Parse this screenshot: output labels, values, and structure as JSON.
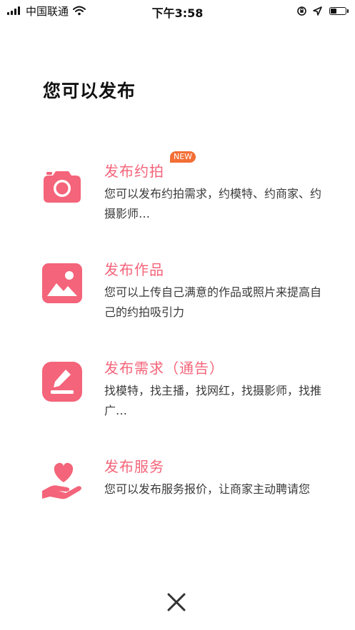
{
  "status_bar": {
    "carrier": "中国联通",
    "time": "下午3:58",
    "battery_level": 0.35
  },
  "page": {
    "title": "您可以发布"
  },
  "options": [
    {
      "title": "发布约拍",
      "description": "您可以发布约拍需求，约模特、约商家、约摄影师…",
      "badge": "NEW",
      "icon": "camera-icon"
    },
    {
      "title": "发布作品",
      "description": "您可以上传自己满意的作品或照片来提高自己的约拍吸引力",
      "icon": "image-icon"
    },
    {
      "title": "发布需求（通告）",
      "description": "找模特，找主播，找网红，找摄影师，找推广…",
      "icon": "edit-icon"
    },
    {
      "title": "发布服务",
      "description": "您可以发布服务报价，让商家主动聘请您",
      "icon": "heart-hand-icon"
    }
  ],
  "colors": {
    "accent": "#f4647a",
    "badge": "#f36f36"
  },
  "close_icon": "close-icon"
}
